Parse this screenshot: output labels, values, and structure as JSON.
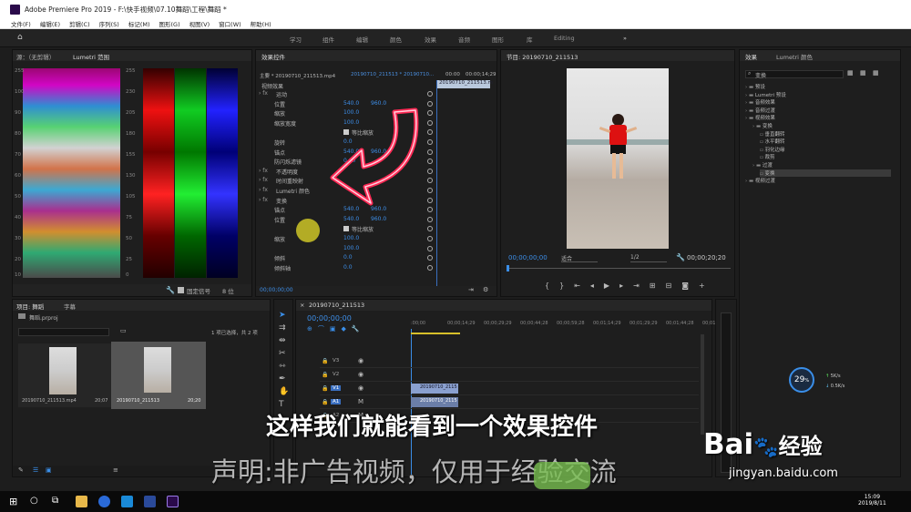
{
  "window": {
    "title": "Adobe Premiere Pro 2019 - F:\\快手视频\\07.10舞蹈\\工程\\舞蹈 *"
  },
  "menu": [
    "文件(F)",
    "编辑(E)",
    "剪辑(C)",
    "序列(S)",
    "标记(M)",
    "图形(G)",
    "视图(V)",
    "窗口(W)",
    "帮助(H)"
  ],
  "workspaces": [
    "学习",
    "组件",
    "编辑",
    "颜色",
    "效果",
    "音频",
    "图形",
    "库",
    "Editing"
  ],
  "source_panel": {
    "tab1": "源：（无剪辑）",
    "tab2": "Lumetri 范围",
    "left_ticks": [
      "255",
      "100",
      "90",
      "80",
      "70",
      "60",
      "50",
      "40",
      "30",
      "20",
      "10",
      "0"
    ],
    "right_ticks": [
      "255",
      "230",
      "205",
      "180",
      "155",
      "130",
      "105",
      "75",
      "50",
      "25",
      "0"
    ],
    "footer_label": "固定信号",
    "footer_value": "8 位"
  },
  "effect_controls": {
    "tab": "效果控件",
    "master": "主要 * 20190710_211513.mp4",
    "sequence": "20190710_211513 * 20190710...",
    "clip_name": "20190710_211513.m",
    "ruler": [
      "00:00",
      "00:00;14;29"
    ],
    "section": "视频效果",
    "rows": [
      {
        "label": "运动",
        "fx": true
      },
      {
        "label": "位置",
        "v1": "540.0",
        "v2": "960.0"
      },
      {
        "label": "缩放",
        "v1": "100.0"
      },
      {
        "label": "缩放宽度",
        "v1": "100.0"
      },
      {
        "label": "等比缩放",
        "check": true
      },
      {
        "label": "旋转",
        "v1": "0.0"
      },
      {
        "label": "锚点",
        "v1": "540.0",
        "v2": "960.0"
      },
      {
        "label": "防闪烁滤镜",
        "v1": "0.00"
      },
      {
        "label": "不透明度",
        "fx": true
      },
      {
        "label": "时间重映射",
        "fx": true
      },
      {
        "label": "Lumetri 颜色",
        "fx": true
      },
      {
        "label": "变换",
        "fx": true
      },
      {
        "label": "锚点",
        "v1": "540.0",
        "v2": "960.0"
      },
      {
        "label": "位置",
        "v1": "540.0",
        "v2": "960.0"
      },
      {
        "label": "等比缩放",
        "check": true
      },
      {
        "label": "缩放",
        "v1": "100.0"
      },
      {
        "label": "",
        "v1": "100.0"
      },
      {
        "label": "倾斜",
        "v1": "0.0"
      },
      {
        "label": "倾斜轴",
        "v1": "0.0"
      }
    ],
    "timecode": "00;00;00;00"
  },
  "program": {
    "tab": "节目: 20190710_211513",
    "timecode_left": "00;00;00;00",
    "fit": "适合",
    "quality": "1/2",
    "timecode_right": "00;00;20;20"
  },
  "effects_panel": {
    "tab1": "效果",
    "tab2": "Lumetri 颜色",
    "search": "变换",
    "tree": [
      {
        "label": "预设",
        "indent": 0
      },
      {
        "label": "Lumetri 预设",
        "indent": 0
      },
      {
        "label": "音频效果",
        "indent": 0
      },
      {
        "label": "音频过渡",
        "indent": 0
      },
      {
        "label": "视频效果",
        "indent": 0
      },
      {
        "label": "变换",
        "indent": 1
      },
      {
        "label": "垂直翻转",
        "indent": 2
      },
      {
        "label": "水平翻转",
        "indent": 2
      },
      {
        "label": "羽化边缘",
        "indent": 2
      },
      {
        "label": "裁剪",
        "indent": 2
      },
      {
        "label": "过渡",
        "indent": 1
      },
      {
        "label": "变换",
        "indent": 2,
        "selected": true
      },
      {
        "label": "视频过渡",
        "indent": 0
      }
    ]
  },
  "project": {
    "tab1": "项目: 舞蹈",
    "tab2": "字幕",
    "file": "舞蹈.prproj",
    "selection": "1 项已选择，共 2 项",
    "items": [
      {
        "name": "20190710_211513.mp4",
        "dur": "20;07"
      },
      {
        "name": "20190710_211513",
        "dur": "20;20"
      }
    ]
  },
  "timeline": {
    "tab": "20190710_211513",
    "timecode": "00;00;00;00",
    "ruler": [
      ":00;00",
      "00;00;14;29",
      "00;00;29;29",
      "00;00;44;28",
      "00;00;59;28",
      "00;01;14;29",
      "00;01;29;29",
      "00;01;44;28",
      "00;01;59"
    ],
    "tracks": [
      "V3",
      "V2",
      "V1",
      "A1",
      "A2"
    ],
    "clip_v": "20190710_2115",
    "clip_a": "20190710_2115",
    "master": "主声道"
  },
  "meter": {
    "percent": "29",
    "unit": "%",
    "up": "5",
    "up_unit": "K/s",
    "down": "0.5",
    "down_unit": "K/s"
  },
  "captions": {
    "main": "这样我们就能看到一个效果控件",
    "watermark": "声明:非广告视频，仅用于经验交流"
  },
  "baidu": {
    "logo": "Bai",
    "logo2": "经验",
    "url": "jingyan.baidu.com"
  },
  "clock": {
    "time": "15:09",
    "date": "2019/8/11"
  }
}
